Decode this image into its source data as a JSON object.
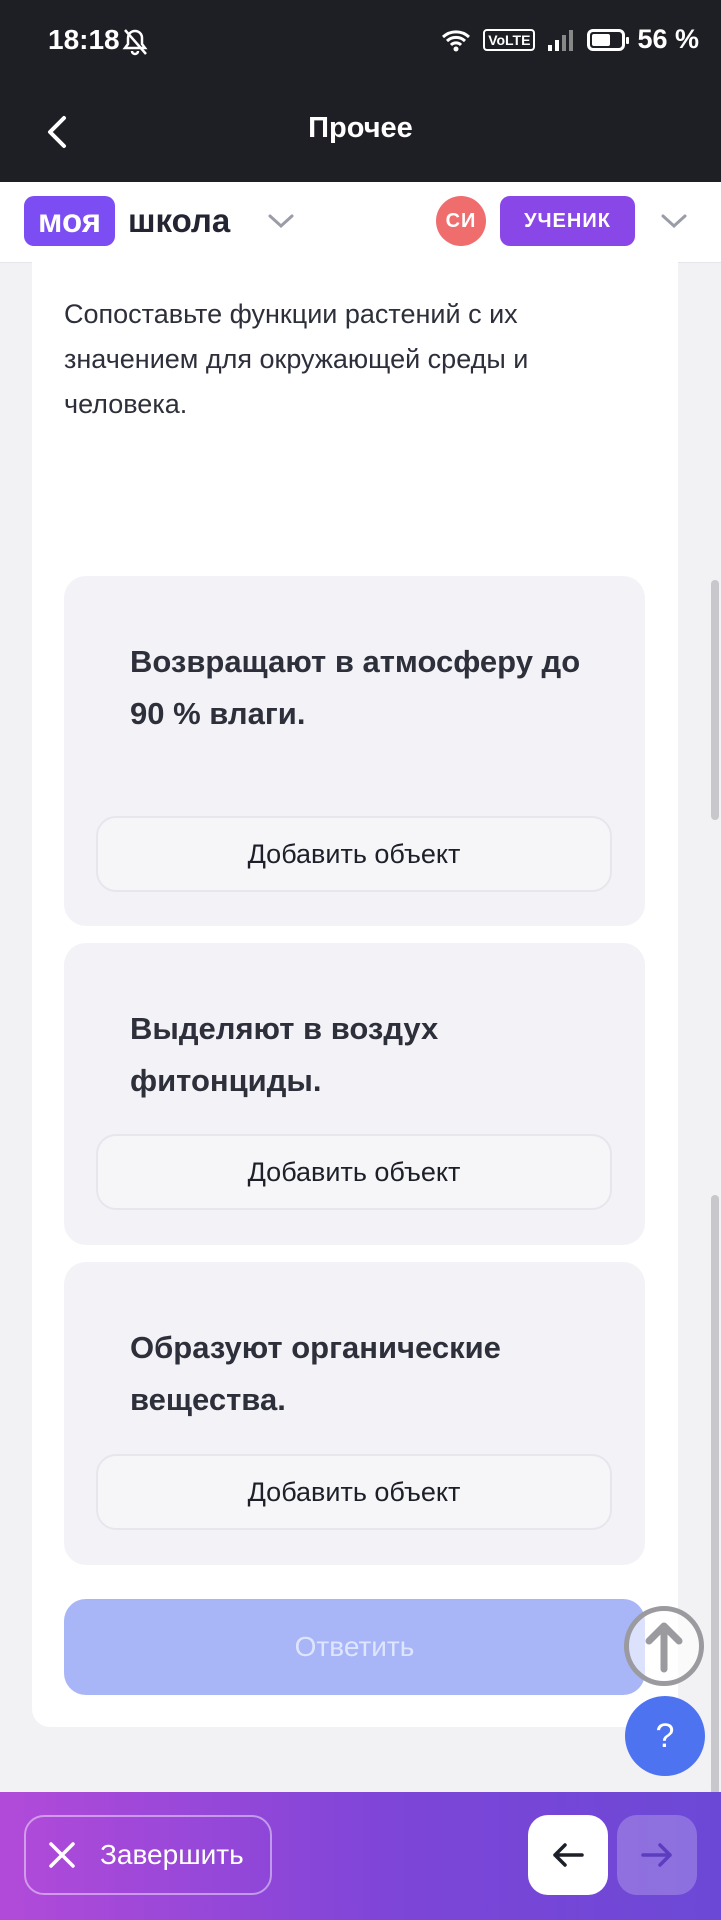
{
  "status_bar": {
    "time": "18:18",
    "network": "VoLTE",
    "battery": "56 %",
    "battery_level": 0.56
  },
  "app_bar": {
    "title": "Прочее"
  },
  "site_header": {
    "logo_part1": "моя",
    "logo_part2": "школа",
    "avatar_initials": "СИ",
    "role": "УЧЕНИК"
  },
  "task": {
    "prompt": "Сопоставьте функции растений с их значением для окружающей среды и человека.",
    "targets": [
      {
        "label": "Возвращают в атмосферу до 90 % влаги.",
        "button": "Добавить объект"
      },
      {
        "label": "Выделяют в воздух фитонциды.",
        "button": "Добавить объект"
      },
      {
        "label": "Образуют органические вещества.",
        "button": "Добавить объект"
      }
    ],
    "answer_button": "Ответить",
    "help_label": "?"
  },
  "bottom_bar": {
    "finish_label": "Завершить"
  },
  "colors": {
    "brand": "#7b4df2",
    "role": "#8a47e8",
    "avatar": "#f06d6d",
    "answer_disabled": "#a8b6f7",
    "help": "#4d73f0"
  }
}
